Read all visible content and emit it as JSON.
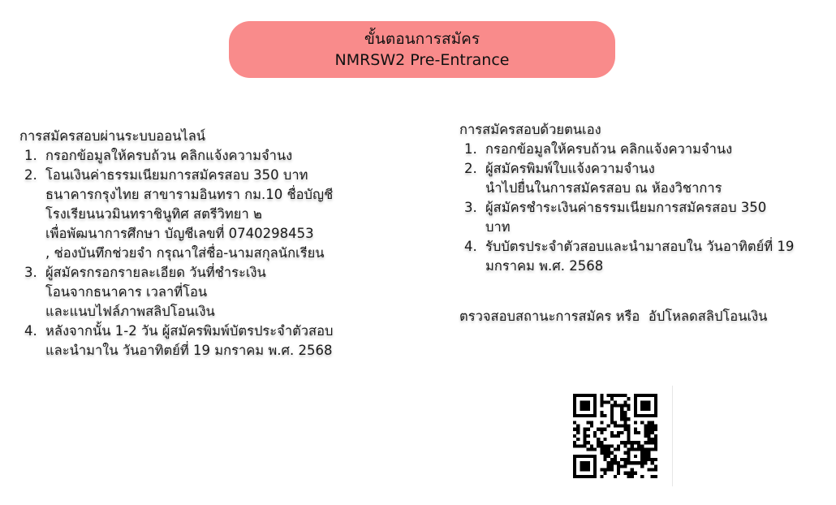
{
  "header": {
    "line1": "ขั้นตอนการสมัคร",
    "line2": "NMRSW2 Pre-Entrance",
    "color": "#f98b8b"
  },
  "online": {
    "title": "การสมัครสอบผ่านระบบออนไลน์",
    "steps": [
      {
        "num": "1.",
        "lines": [
          "กรอกข้อมูลให้ครบถ้วน คลิกแจ้งความจำนง"
        ]
      },
      {
        "num": "2.",
        "lines": [
          "โอนเงินค่าธรรมเนียมการสมัครสอบ 350 บาท",
          "ธนาคารกรุงไทย สาขารามอินทรา กม.10 ชื่อบัญชี",
          "โรงเรียนนวมินทราชินูทิศ สตรีวิทยา ๒",
          "เพื่อพัฒนาการศึกษา บัญชีเลขที่ 0740298453",
          ", ช่องบันทึกช่วยจำ กรุณาใส่ชื่อ-นามสกุลนักเรียน"
        ]
      },
      {
        "num": "3.",
        "lines": [
          "ผู้สมัครกรอกรายละเอียด วันที่ชำระเงิน",
          "โอนจากธนาคาร เวลาที่โอน",
          "และแนบไฟล์ภาพสลิปโอนเงิน"
        ]
      },
      {
        "num": "4.",
        "lines": [
          "หลังจากนั้น 1-2 วัน ผู้สมัครพิมพ์บัตรประจำตัวสอบ",
          "และนำมาใน วันอาทิตย์ที่ 19 มกราคม พ.ศ. 2568"
        ]
      }
    ]
  },
  "offline": {
    "title": "การสมัครสอบด้วยตนเอง",
    "steps": [
      {
        "num": "1.",
        "lines": [
          "กรอกข้อมูลให้ครบถ้วน คลิกแจ้งความจำนง"
        ]
      },
      {
        "num": "2.",
        "lines": [
          "ผู้สมัครพิมพ์ใบแจ้งความจำนง",
          "นำไปยื่นในการสมัครสอบ ณ ห้องวิชาการ"
        ]
      },
      {
        "num": "3.",
        "lines": [
          "ผู้สมัครชำระเงินค่าธรรมเนียมการสมัครสอบ 350",
          "บาท"
        ]
      },
      {
        "num": "4.",
        "lines": [
          "รับบัตรประจำตัวสอบและนำมาสอบใน วันอาทิตย์ที่ 19",
          "มกราคม พ.ศ. 2568"
        ]
      }
    ]
  },
  "status": {
    "check_label": "ตรวจสอบสถานะการสมัคร",
    "or_label": "หรือ",
    "upload_label": "อัปโหลดสลิปโอนเงิน"
  },
  "qr": {
    "icon": "qr-code-icon",
    "color": "#000000"
  }
}
